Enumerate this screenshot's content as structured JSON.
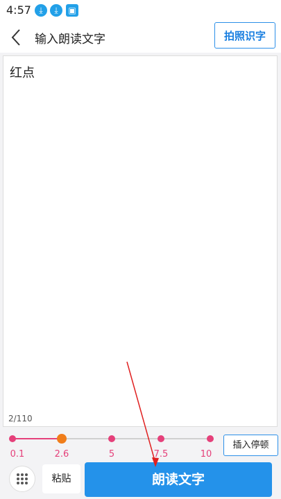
{
  "status_bar": {
    "time": "4:57",
    "icons": [
      "download-icon",
      "download-icon",
      "image-icon"
    ]
  },
  "header": {
    "title": "输入朗读文字",
    "ocr_label": "拍照识字"
  },
  "editor": {
    "text": "红点",
    "counter": "2/110"
  },
  "speed": {
    "ticks": [
      "0.1",
      "2.6",
      "5",
      "7.5",
      "10"
    ],
    "selected": "2.6",
    "active_color": "#f07d1a",
    "dot_color": "#e5407a"
  },
  "pause_label": "插入停顿",
  "bottom": {
    "paste_label": "粘贴",
    "read_label": "朗读文字"
  },
  "accent": "#2492ea",
  "annotation_arrow_color": "#e02020"
}
